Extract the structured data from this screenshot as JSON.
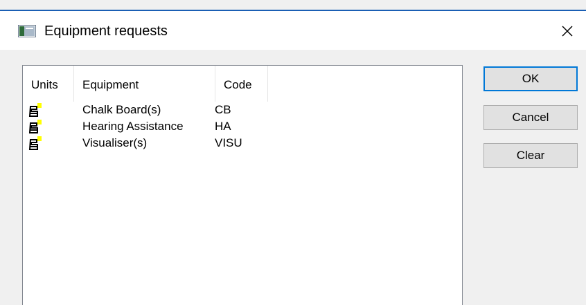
{
  "dialog": {
    "title": "Equipment requests",
    "icon": "window-app-icon",
    "close_icon": "close-icon"
  },
  "list": {
    "columns": [
      "Units",
      "Equipment",
      "Code"
    ],
    "rows": [
      {
        "icon": "equipment-unit-icon",
        "equipment": "Chalk Board(s)",
        "code": "CB"
      },
      {
        "icon": "equipment-unit-icon",
        "equipment": "Hearing Assistance",
        "code": "HA"
      },
      {
        "icon": "equipment-unit-icon",
        "equipment": "Visualiser(s)",
        "code": "VISU"
      }
    ]
  },
  "buttons": {
    "ok": "OK",
    "cancel": "Cancel",
    "clear": "Clear"
  },
  "colors": {
    "accent": "#1a5fb4",
    "default_button_border": "#0078d7",
    "icon_highlight": "#ffff00"
  }
}
